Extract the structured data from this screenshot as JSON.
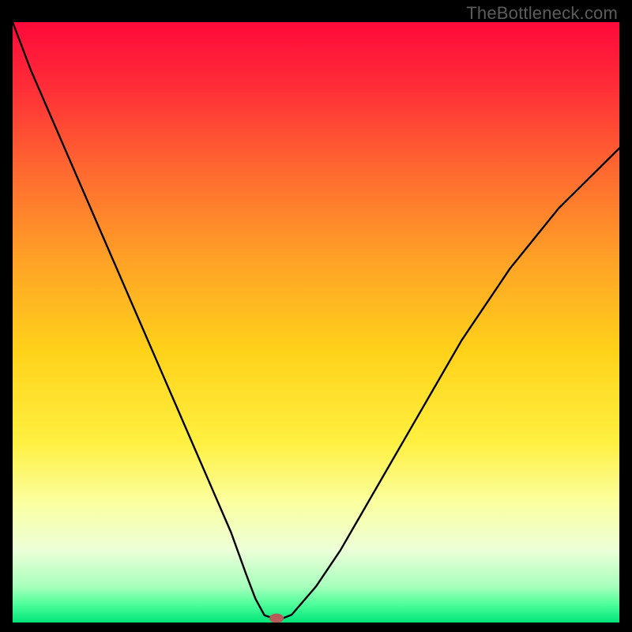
{
  "watermark": "TheBottleneck.com",
  "chart_data": {
    "type": "line",
    "title": "",
    "xlabel": "",
    "ylabel": "",
    "xlim": [
      0,
      100
    ],
    "ylim": [
      0,
      100
    ],
    "background_gradient": {
      "stops": [
        {
          "pos": 0.0,
          "color": "#ff0a3a"
        },
        {
          "pos": 0.1,
          "color": "#ff2a38"
        },
        {
          "pos": 0.25,
          "color": "#ff6a30"
        },
        {
          "pos": 0.4,
          "color": "#ffa326"
        },
        {
          "pos": 0.55,
          "color": "#ffd21a"
        },
        {
          "pos": 0.7,
          "color": "#fff040"
        },
        {
          "pos": 0.8,
          "color": "#fbffa0"
        },
        {
          "pos": 0.88,
          "color": "#ecffd8"
        },
        {
          "pos": 0.94,
          "color": "#a7ffbc"
        },
        {
          "pos": 0.97,
          "color": "#4dff9a"
        },
        {
          "pos": 1.0,
          "color": "#00e47a"
        }
      ]
    },
    "series": [
      {
        "name": "bottleneck-curve",
        "color": "#000000",
        "x": [
          0,
          3,
          6,
          9,
          12,
          15,
          18,
          21,
          24,
          27,
          30,
          33,
          36,
          38.5,
          40,
          41.5,
          43,
          44.5,
          46,
          50,
          54,
          58,
          62,
          66,
          70,
          74,
          78,
          82,
          86,
          90,
          94,
          98,
          100
        ],
        "y": [
          100,
          92,
          85,
          78,
          71,
          64,
          57,
          50,
          43,
          36,
          29,
          22,
          15,
          8,
          4,
          1.2,
          0.7,
          0.7,
          1.3,
          6,
          12,
          19,
          26,
          33,
          40,
          47,
          53,
          59,
          64,
          69,
          73,
          77,
          79
        ]
      }
    ],
    "marker": {
      "name": "optimal-point",
      "x": 43.5,
      "y": 0.7,
      "color": "#b85a5a",
      "rx": 9,
      "ry": 6
    },
    "frame": {
      "color": "#000000",
      "inner_size": [
        768,
        760
      ]
    }
  }
}
